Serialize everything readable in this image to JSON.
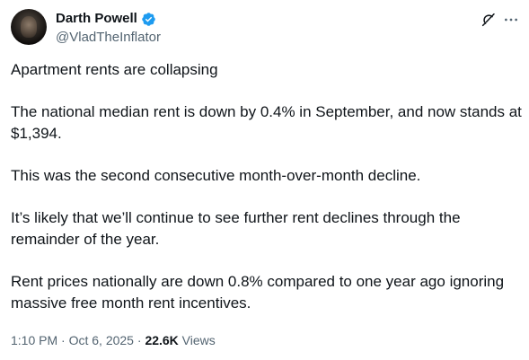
{
  "author": {
    "display_name": "Darth Powell",
    "handle": "@VladTheInflator",
    "verified": true,
    "verified_color": "#1d9bf0"
  },
  "header_actions": {
    "grok_icon": "grok-icon",
    "more_icon": "more-horizontal-icon"
  },
  "tweet": {
    "paragraphs": [
      "Apartment rents are collapsing",
      "The national median rent is down by 0.4% in September, and now stands at $1,394.",
      "This was the second consecutive month-over-month decline.",
      "It’s likely that we’ll continue to see further rent declines through the remainder of the year.",
      "Rent prices nationally are down 0.8% compared to one year ago ignoring massive free month rent incentives."
    ]
  },
  "meta": {
    "time": "1:10 PM",
    "separator": " · ",
    "date": "Oct 6, 2025",
    "views_count": "22.6K",
    "views_label": " Views"
  },
  "colors": {
    "text_primary": "#0f1419",
    "text_secondary": "#536471",
    "background": "#ffffff"
  }
}
